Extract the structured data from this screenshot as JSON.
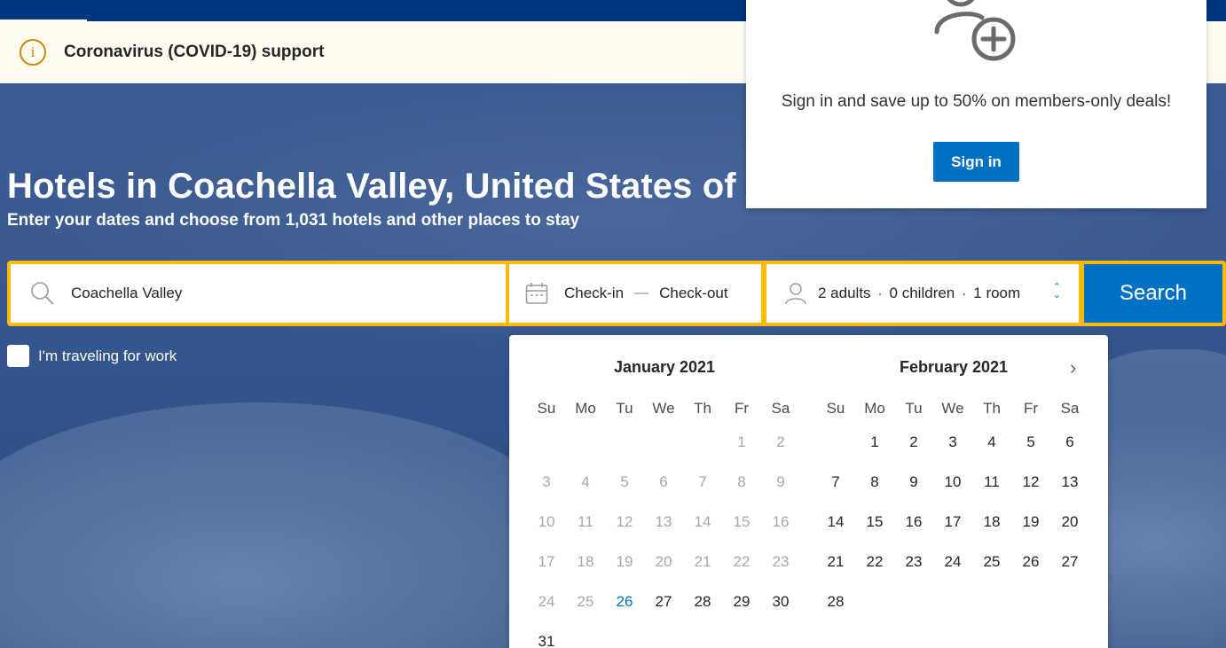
{
  "banner": {
    "text": "Coronavirus (COVID-19) support",
    "info_icon": "i"
  },
  "hero": {
    "title": "Hotels in Coachella Valley, United States of America",
    "subtitle": "Enter your dates and choose from 1,031 hotels and other places to stay"
  },
  "search": {
    "destination": "Coachella Valley",
    "checkin": "Check-in",
    "dash": "—",
    "checkout": "Check-out",
    "adults": "2 adults",
    "children": "0 children",
    "rooms": "1 room",
    "dot": "·",
    "button": "Search"
  },
  "work": {
    "label": "I'm traveling for work"
  },
  "calendar": {
    "weekdays": [
      "Su",
      "Mo",
      "Tu",
      "We",
      "Th",
      "Fr",
      "Sa"
    ],
    "months": [
      {
        "title": "January 2021",
        "leading_blanks": 5,
        "days": 31,
        "past_until": 25,
        "today": 26
      },
      {
        "title": "February 2021",
        "leading_blanks": 1,
        "days": 28,
        "past_until": 0,
        "today": 0
      }
    ],
    "next_icon": "›"
  },
  "popup": {
    "message": "Sign in and save up to 50% on members-only deals!",
    "button": "Sign in"
  },
  "colors": {
    "brand_blue": "#003580",
    "action_blue": "#0071c2",
    "search_border": "#febb02",
    "banner_bg": "#fffdf2"
  }
}
